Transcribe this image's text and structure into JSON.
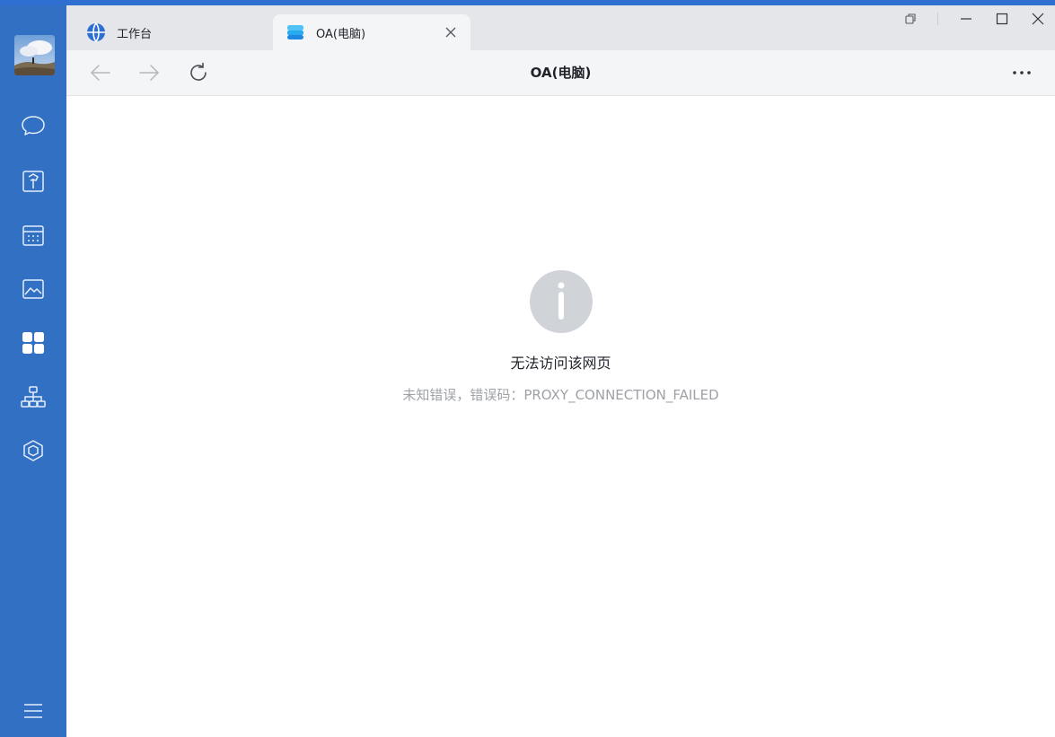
{
  "tabs": [
    {
      "label": "工作台",
      "icon": "globe-icon"
    },
    {
      "label": "OA(电脑)",
      "icon": "app-stack-icon",
      "active": true
    }
  ],
  "toolbar": {
    "title": "OA(电脑)"
  },
  "error": {
    "title": "无法访问该网页",
    "detail": "未知错误，错误码：PROXY_CONNECTION_FAILED"
  },
  "sidebar": {
    "items": [
      {
        "name": "messages",
        "icon": "chat-bubble-icon"
      },
      {
        "name": "docs",
        "icon": "document-icon"
      },
      {
        "name": "calendar",
        "icon": "calendar-icon"
      },
      {
        "name": "gallery",
        "icon": "image-icon"
      },
      {
        "name": "workbench",
        "icon": "apps-grid-icon",
        "active": true
      },
      {
        "name": "organization",
        "icon": "org-chart-icon"
      },
      {
        "name": "apps",
        "icon": "cube-icon"
      }
    ]
  },
  "colors": {
    "sidebar_bg": "#3170c2",
    "accent": "#2f6fd1",
    "tabbar_bg": "#e4e6ea",
    "error_icon": "#d0d3d8"
  }
}
